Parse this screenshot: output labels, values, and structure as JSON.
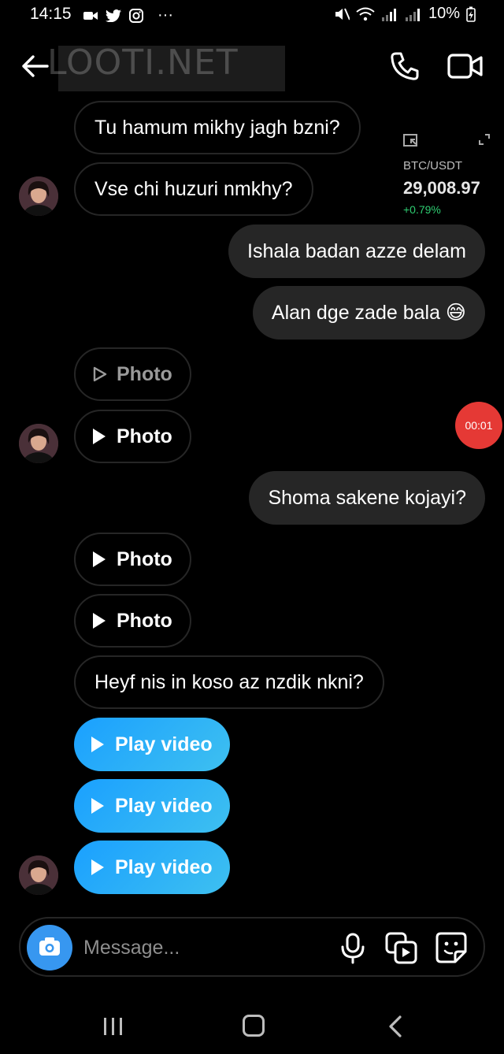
{
  "status_bar": {
    "time": "14:15",
    "dots": "···",
    "battery": "10%"
  },
  "header": {
    "watermark": "LOOTI.NET"
  },
  "btc_widget": {
    "pair": "BTC/USDT",
    "price": "29,008.97",
    "change": "+0.79%",
    "change_color": "#2ecc71"
  },
  "record_badge": "00:01",
  "messages": [
    {
      "side": "in",
      "text": "Tu hamum mikhy jagh bzni?"
    },
    {
      "side": "in",
      "text": "Vse chi huzuri nmkhy?"
    },
    {
      "side": "out",
      "text": "Ishala badan azze delam"
    },
    {
      "side": "out",
      "text": "Alan dge zade bala 😅"
    },
    {
      "side": "in",
      "kind": "photo",
      "text": "Photo"
    },
    {
      "side": "in",
      "kind": "photo",
      "text": "Photo"
    },
    {
      "side": "out",
      "text": "Shoma sakene kojayi?"
    },
    {
      "side": "in",
      "kind": "photo",
      "text": "Photo"
    },
    {
      "side": "in",
      "kind": "photo",
      "text": "Photo"
    },
    {
      "side": "in",
      "text": "Heyf nis in koso az nzdik nkni?"
    },
    {
      "side": "in",
      "kind": "video",
      "text": "Play video"
    },
    {
      "side": "in",
      "kind": "video",
      "text": "Play video"
    },
    {
      "side": "in",
      "kind": "video",
      "text": "Play video"
    }
  ],
  "composer": {
    "placeholder": "Message...",
    "accent": "#3797f0"
  },
  "colors": {
    "background": "#000000",
    "outgoing_bubble": "#262626",
    "video_gradient_start": "#1aa0ff",
    "video_gradient_end": "#3ec0f0"
  }
}
